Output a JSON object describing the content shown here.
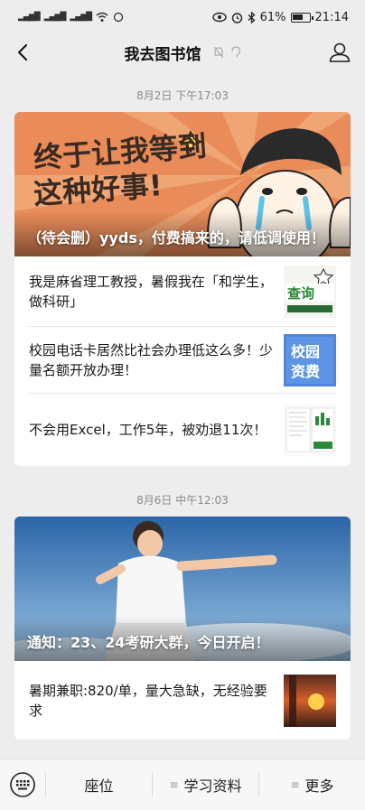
{
  "status": {
    "left_signals": [
      "46",
      "5G",
      "46",
      "wifi",
      "loading"
    ],
    "battery": "61%",
    "time": "21:14"
  },
  "nav": {
    "title": "我去图书馆"
  },
  "feed": [
    {
      "timestamp": "8月2日 下午17:03",
      "cover_caption": "（待会删）yyds，付费搞来的，请低调使用！",
      "cover_art_text": "终于让我等到这种好事！",
      "items": [
        {
          "title": "我是麻省理工教授，暑假我在「和学生，做科研」",
          "thumb_text": "查询"
        },
        {
          "title": "校园电话卡居然比社会办理低这么多！少量名额开放办理！",
          "thumb_text": "校园资费"
        },
        {
          "title": "不会用Excel，工作5年，被劝退11次！",
          "thumb_text": ""
        }
      ]
    },
    {
      "timestamp": "8月6日 中午12:03",
      "cover_caption": "通知：23、24考研大群，今日开启！",
      "items": [
        {
          "title": "暑期兼职:820/单，量大急缺，无经验要求",
          "thumb_text": ""
        }
      ]
    }
  ],
  "bottom_menu": {
    "items": [
      {
        "label": "座位"
      },
      {
        "label": "学习资料"
      },
      {
        "label": "更多"
      }
    ]
  },
  "colors": {
    "page_bg": "#ededed",
    "card_bg": "#ffffff",
    "cover1_bg": "#e98c5a",
    "cover2_sky": "#2f6fb0"
  }
}
